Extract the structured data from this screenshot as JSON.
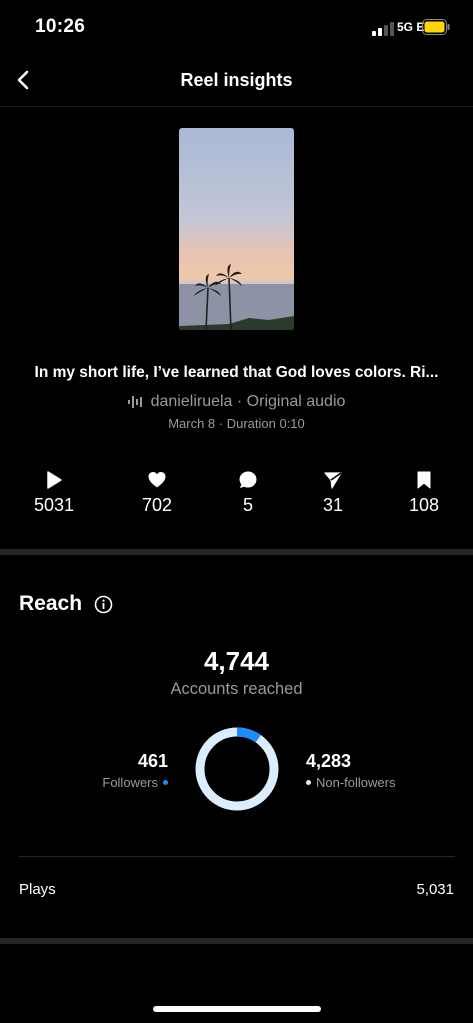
{
  "status_bar": {
    "time": "10:26",
    "network": "5G E"
  },
  "nav": {
    "title": "Reel insights"
  },
  "reel": {
    "caption": "In my short life, I’ve learned that God loves colors. Ri...",
    "audio_text": "danieliruela · Original audio",
    "meta": "March 8 · Duration 0:10"
  },
  "metrics": [
    {
      "icon": "play-icon",
      "value": "5031"
    },
    {
      "icon": "heart-icon",
      "value": "702"
    },
    {
      "icon": "comment-icon",
      "value": "5"
    },
    {
      "icon": "share-icon",
      "value": "31"
    },
    {
      "icon": "bookmark-icon",
      "value": "108"
    }
  ],
  "reach": {
    "title": "Reach",
    "accounts_value": "4,744",
    "accounts_label": "Accounts reached",
    "followers_value": "461",
    "followers_label": "Followers",
    "nonfollowers_value": "4,283",
    "nonfollowers_label": "Non-followers",
    "followers_fraction": 0.097
  },
  "plays": {
    "label": "Plays",
    "value": "5,031"
  },
  "colors": {
    "accent": "#1a8cff",
    "light_ring": "#dbeeff",
    "divider": "#262626"
  }
}
